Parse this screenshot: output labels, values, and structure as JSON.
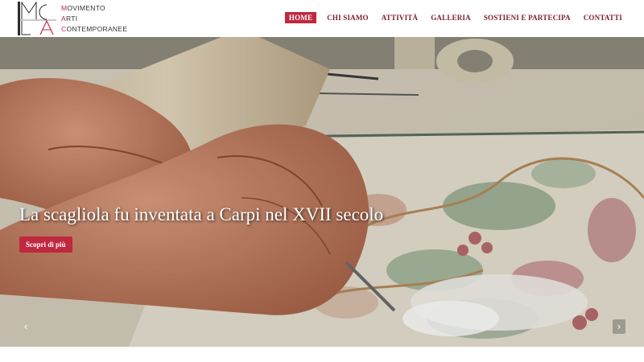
{
  "logo": {
    "letters": "MCLA",
    "vertical_text": "MOVIMENTO ARTI CONTEMPORANEE",
    "line1_initial": "M",
    "line1_rest": "OVIMENTO",
    "line2_initial": "A",
    "line2_rest": "RTI",
    "line3_initial": "C",
    "line3_rest": "ONTEMPORANEE"
  },
  "nav": {
    "items": [
      {
        "label": "HOME",
        "active": true
      },
      {
        "label": "CHI SIAMO"
      },
      {
        "label": "ATTIVITÀ"
      },
      {
        "label": "GALLERIA"
      },
      {
        "label": "SOSTIENI E PARTECIPA"
      },
      {
        "label": "CONTATTI"
      }
    ]
  },
  "hero": {
    "title": "La scagliola fu inventata a Carpi nel XVII secolo",
    "button_label": "Scopri di più",
    "prev_arrow": "‹",
    "next_arrow": "›"
  },
  "colors": {
    "accent": "#c0283f",
    "nav_text": "#7a1f2b"
  },
  "icons": {
    "prev": "chevron-left-icon",
    "next": "chevron-right-icon"
  }
}
